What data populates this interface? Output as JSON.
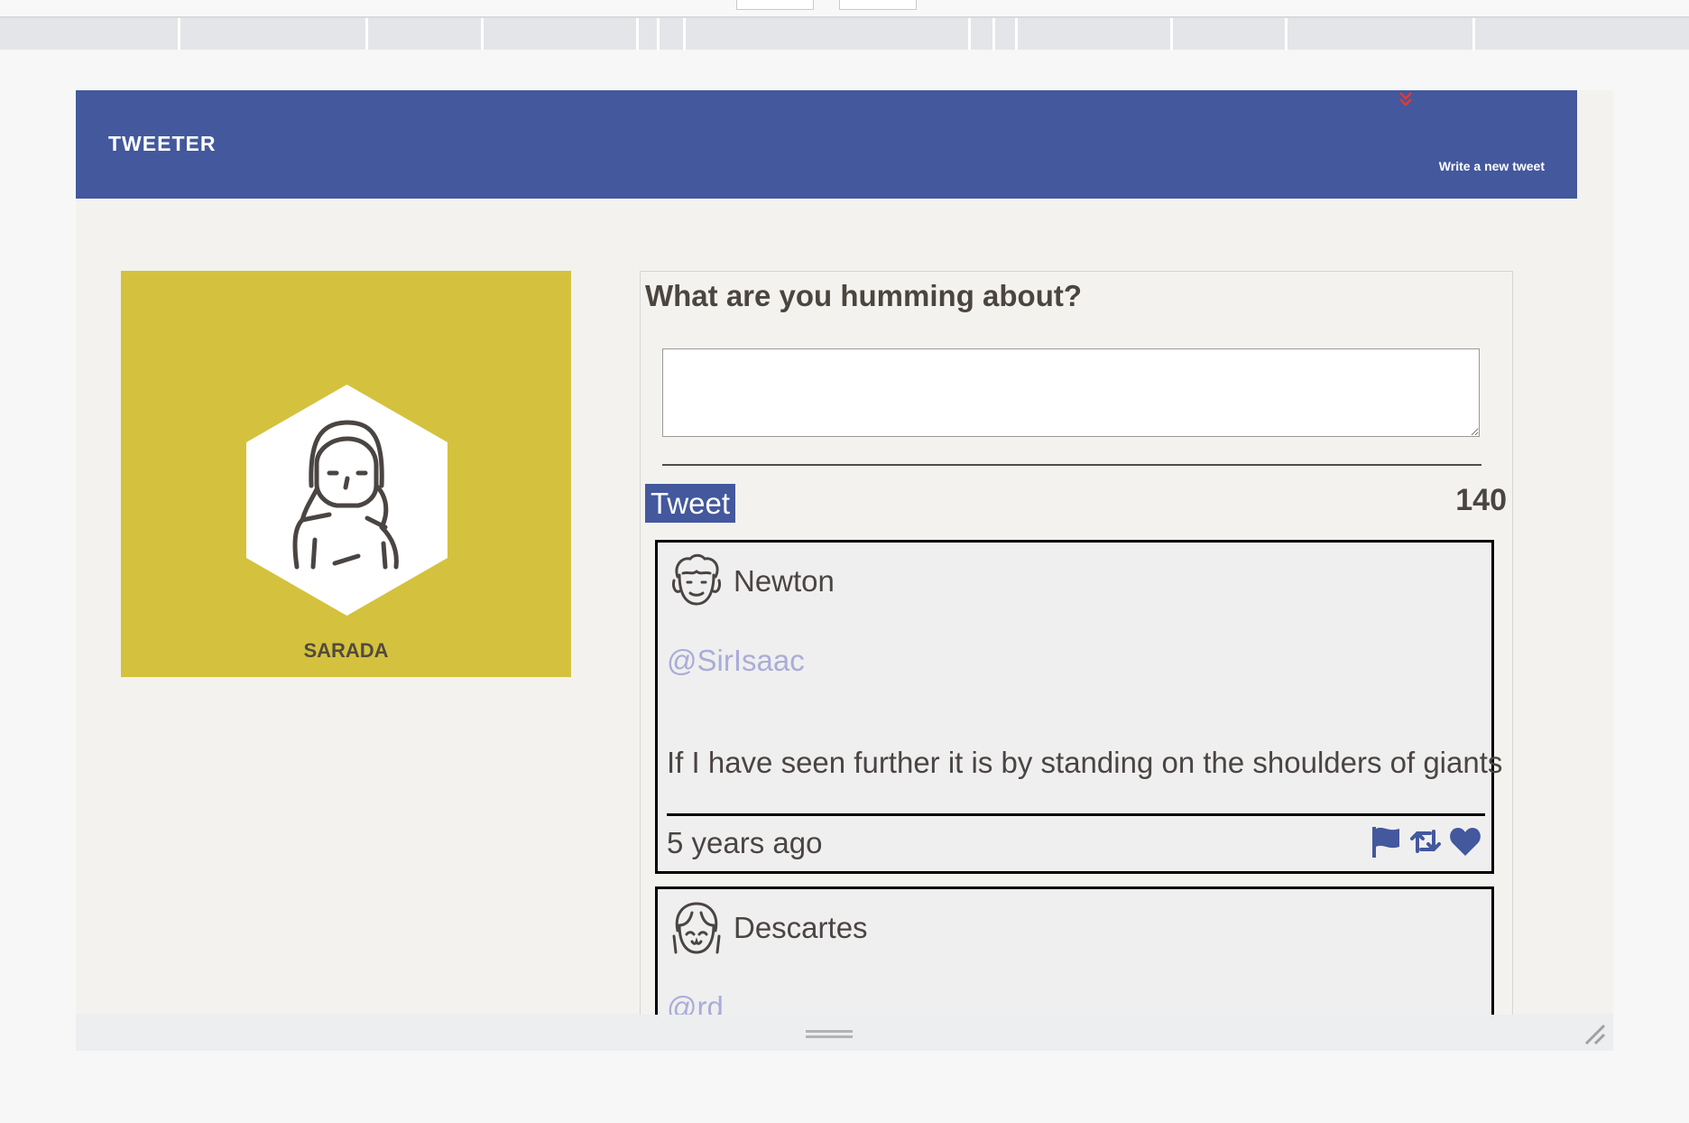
{
  "header": {
    "brand": "TWEETER",
    "write_link": "Write a new tweet"
  },
  "profile": {
    "name": "SARADA"
  },
  "composer": {
    "prompt": "What are you humming about?",
    "input_value": "",
    "submit_label": "Tweet",
    "counter": "140"
  },
  "tweets": [
    {
      "name": "Newton",
      "handle": "@SirIsaac",
      "text": "If I have seen further it is by standing on the shoulders of giants",
      "age": "5 years ago"
    },
    {
      "name": "Descartes",
      "handle": "@rd"
    }
  ],
  "icons": {
    "flag": "flag-icon",
    "retweet": "retweet-icon",
    "like": "heart-icon",
    "chevron": "chevron-double-down-icon"
  },
  "colors": {
    "header": "#43589d",
    "profile_bg": "#d4c23e",
    "accent": "#43589d",
    "chevron": "#e03a3a",
    "handle": "#a9add8"
  }
}
